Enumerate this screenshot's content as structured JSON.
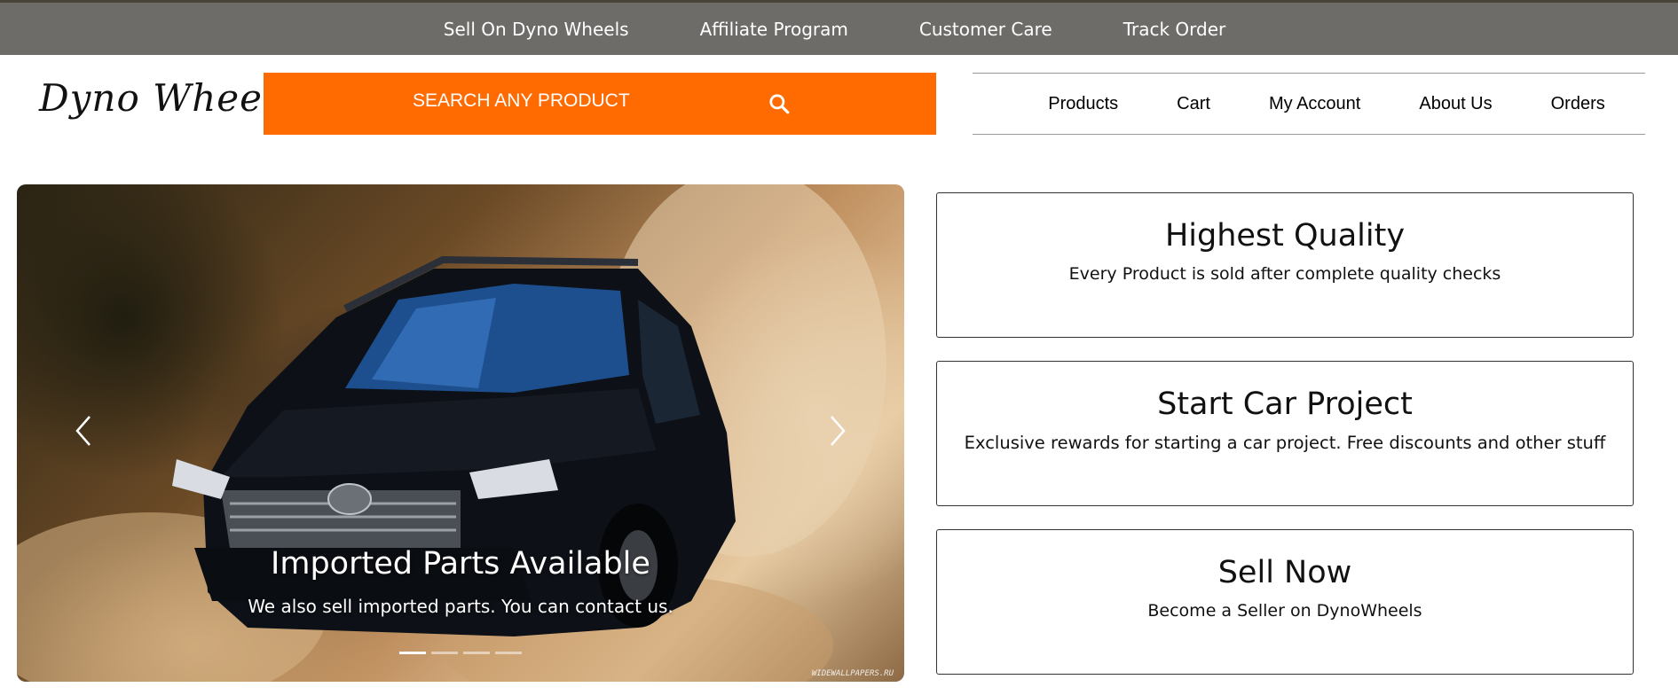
{
  "topbar": {
    "links": [
      "Sell On Dyno Wheels",
      "Affiliate Program",
      "Customer Care",
      "Track Order"
    ]
  },
  "header": {
    "logo": "Dyno Wheels",
    "search_placeholder": "SEARCH ANY PRODUCT",
    "search_icon": "search-icon"
  },
  "nav": {
    "items": [
      "Products",
      "Cart",
      "My Account",
      "About Us",
      "Orders"
    ]
  },
  "carousel": {
    "title": "Imported Parts Available",
    "text": "We also sell imported parts. You can contact us.",
    "slide_count": 4,
    "active_slide": 1,
    "prev_icon": "chevron-left-icon",
    "next_icon": "chevron-right-icon",
    "watermark": "WIDEWALLPAPERS.RU"
  },
  "features": [
    {
      "title": "Highest Quality",
      "text": "Every Product is sold after complete quality checks"
    },
    {
      "title": "Start Car Project",
      "text": "Exclusive rewards for starting a car project. Free discounts and other stuff"
    },
    {
      "title": "Sell Now",
      "text": "Become a Seller on DynoWheels"
    }
  ],
  "colors": {
    "accent": "#ff6b00",
    "topbar": "#6e6c69"
  }
}
